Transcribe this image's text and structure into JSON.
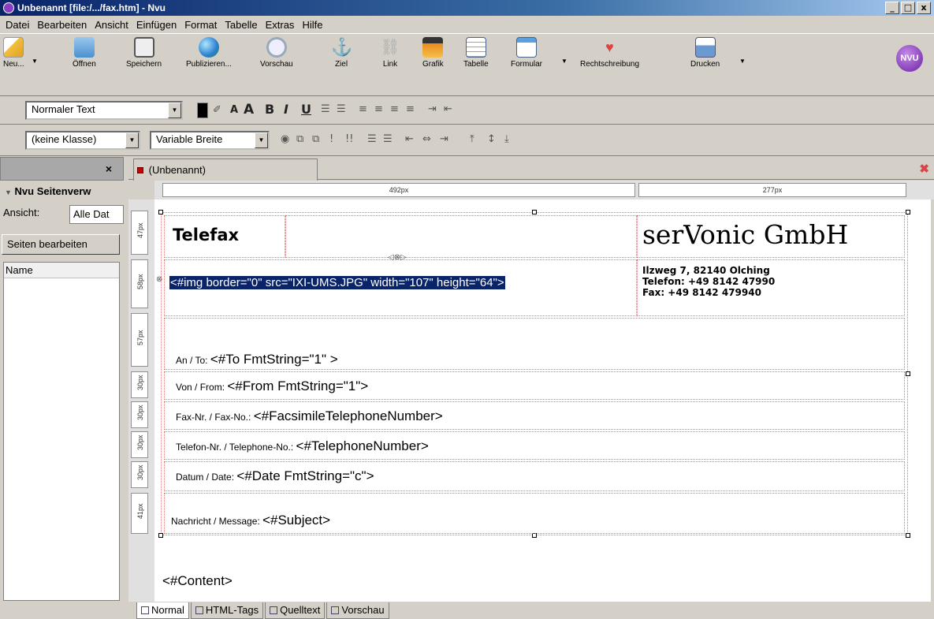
{
  "window": {
    "title": "Unbenannt [file:/.../fax.htm] - Nvu",
    "btn_min": "_",
    "btn_max": "□",
    "btn_close": "x"
  },
  "menu": [
    "Datei",
    "Bearbeiten",
    "Ansicht",
    "Einfügen",
    "Format",
    "Tabelle",
    "Extras",
    "Hilfe"
  ],
  "toolbar": {
    "new": "Neu...",
    "open": "Öffnen",
    "save": "Speichern",
    "publish": "Publizieren...",
    "preview": "Vorschau",
    "anchor": "Ziel",
    "link": "Link",
    "image": "Grafik",
    "table": "Tabelle",
    "form": "Formular",
    "spell": "Rechtschreibung",
    "print": "Drucken",
    "logo": "NVU"
  },
  "format_bar": {
    "paragraph_style": "Normaler Text",
    "class_style": "(keine Klasse)",
    "width_style": "Variable Breite"
  },
  "sidebar": {
    "title": "Nvu Seitenverw",
    "close": "×",
    "view_label": "Ansicht:",
    "view_value": "Alle Dat",
    "edit_button": "Seiten bearbeiten",
    "column_header": "Name"
  },
  "editor": {
    "tab_title": "(Unbenannt)",
    "ruler_col1": "492px",
    "ruler_col2": "277px",
    "row_heights": [
      "47px",
      "58px",
      "57px",
      "30px",
      "30px",
      "30px",
      "30px",
      "41px"
    ],
    "telefax": "Telefax",
    "company": "serVonic GmbH",
    "img_tag": "<#img border=\"0\" src=\"IXI-UMS.JPG\" width=\"107\" height=\"64\">",
    "address": "Ilzweg 7, 82140 Olching",
    "phone": "Telefon: +49 8142 47990",
    "fax": "Fax: +49 8142 479940",
    "to_label": "An / To:",
    "to_value": "<#To FmtString=\"1\" >",
    "from_label": "Von / From:",
    "from_value": "<#From FmtString=\"1\">",
    "faxno_label": "Fax-Nr. / Fax-No.:",
    "faxno_value": "<#FacsimileTelephoneNumber>",
    "telno_label": "Telefon-Nr. / Telephone-No.:",
    "telno_value": "<#TelephoneNumber>",
    "date_label": "Datum / Date:",
    "date_value": "<#Date FmtString=\"c\">",
    "msg_label": "Nachricht / Message:",
    "msg_value": "<#Subject>",
    "content": "<#Content>"
  },
  "view_tabs": [
    "Normal",
    "HTML-Tags",
    "Quelltext",
    "Vorschau"
  ]
}
